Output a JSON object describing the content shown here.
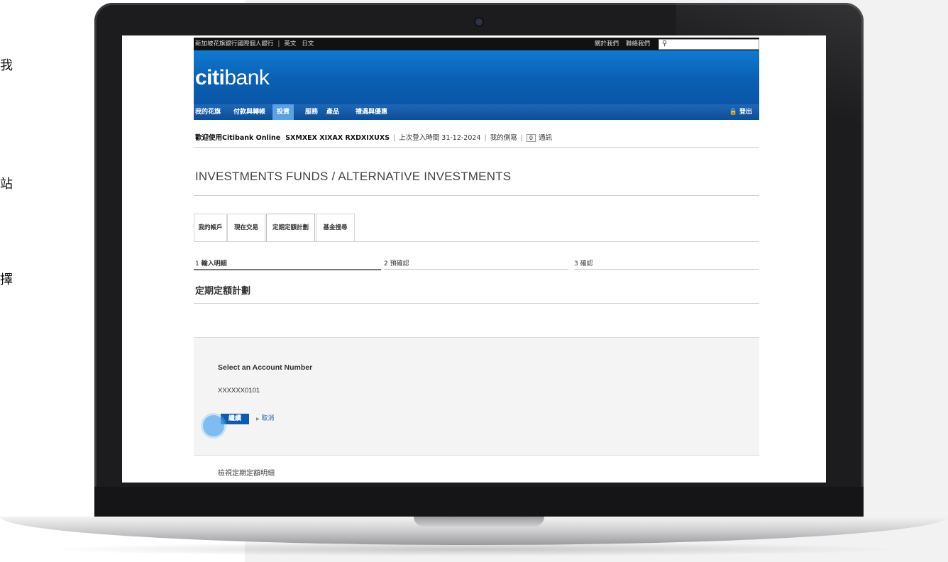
{
  "side_text": [
    "我",
    "站",
    "擇"
  ],
  "topbar": {
    "left_title": "新加坡花旗銀行國際個人銀行",
    "lang_en": "英文",
    "lang_jp": "日文",
    "about": "關於我們",
    "contact": "聯絡我們",
    "search_placeholder": ""
  },
  "logo": {
    "part1": "citi",
    "part2": "bank"
  },
  "nav": {
    "items": [
      "我的花旗",
      "付款與轉帳",
      "投資",
      "服務",
      "產品",
      "禮遇與優惠"
    ],
    "active_index": 2,
    "logout": "登出"
  },
  "welcome": {
    "prefix": "歡迎使用Citibank Online",
    "user": "SXMXEX XIXAX RXDXIXUXS",
    "last_login": "上次登入時間 31-12-2024",
    "profile": "我的側寫",
    "msg_count": "0",
    "messages": "通訊"
  },
  "page_title": "INVESTMENTS FUNDS / ALTERNATIVE INVESTMENTS",
  "tabs": [
    "我的帳戶",
    "現在交易",
    "定期定額計劃",
    "基金搜尋"
  ],
  "active_tab": 2,
  "steps": [
    {
      "num": "1",
      "label": "輸入明細",
      "active": true
    },
    {
      "num": "2",
      "label": "預確認",
      "active": false
    },
    {
      "num": "3",
      "label": "確認",
      "active": false
    }
  ],
  "section_title": "定期定額計劃",
  "account_form": {
    "label": "Select an Account Number",
    "account": "XXXXXX0101",
    "continue": "繼續",
    "cancel": "取消"
  },
  "view_details": "檢視定期定額明細",
  "colors": {
    "brand_blue": "#0a5fb2",
    "active_nav": "#5aa0e4",
    "button": "#0b5bb0"
  }
}
